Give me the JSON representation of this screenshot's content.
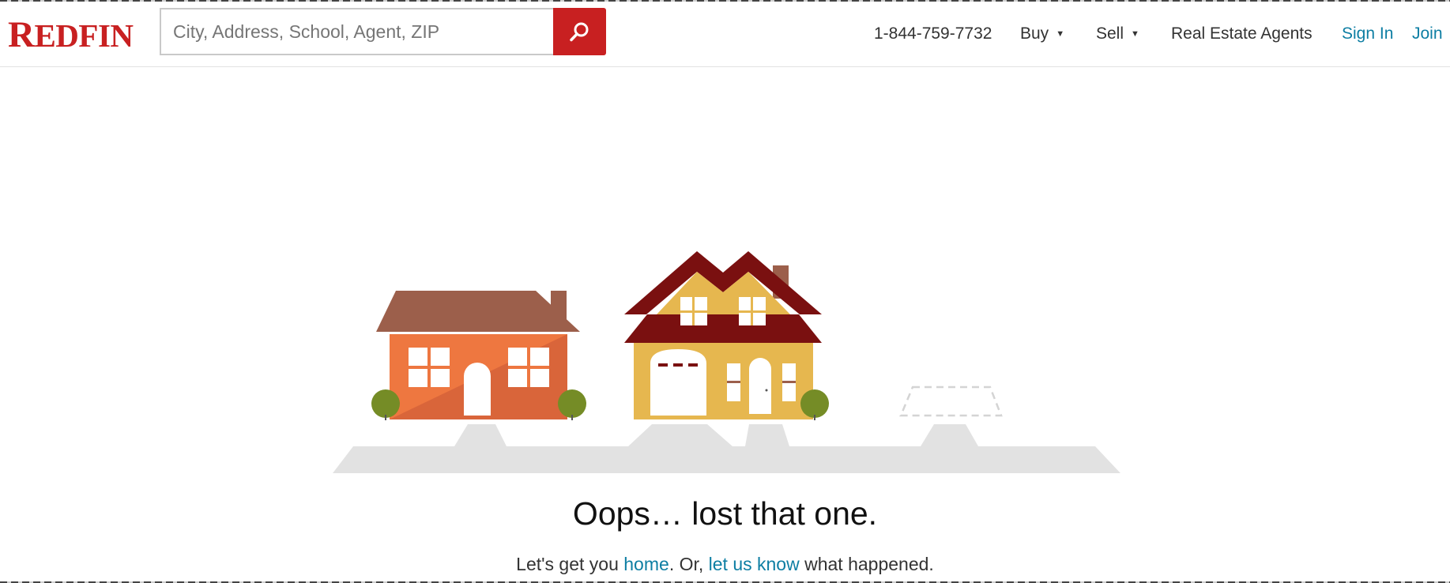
{
  "header": {
    "logo": {
      "first": "R",
      "rest": "EDFIN"
    },
    "search": {
      "placeholder": "City, Address, School, Agent, ZIP"
    },
    "phone": "1-844-759-7732",
    "nav": {
      "buy": "Buy",
      "sell": "Sell",
      "agents": "Real Estate Agents",
      "sign_in": "Sign In",
      "join": "Join"
    },
    "caret": "▼"
  },
  "error": {
    "headline": "Oops… lost that one.",
    "message": {
      "prefix": "Let's get you ",
      "home_link": "home",
      "middle": ". Or, ",
      "feedback_link": "let us know",
      "suffix": " what happened."
    }
  },
  "colors": {
    "brand_red": "#c82021",
    "link_blue": "#0d7ea3",
    "house_orange": "#ee7740",
    "house_yellow": "#e6b74f",
    "roof_brown": "#9c5f4b",
    "roof_dark_red": "#7a1010",
    "tree_green": "#758c26",
    "ground_grey": "#e2e2e2"
  },
  "icons": [
    "search-icon",
    "chevron-down-icon"
  ]
}
